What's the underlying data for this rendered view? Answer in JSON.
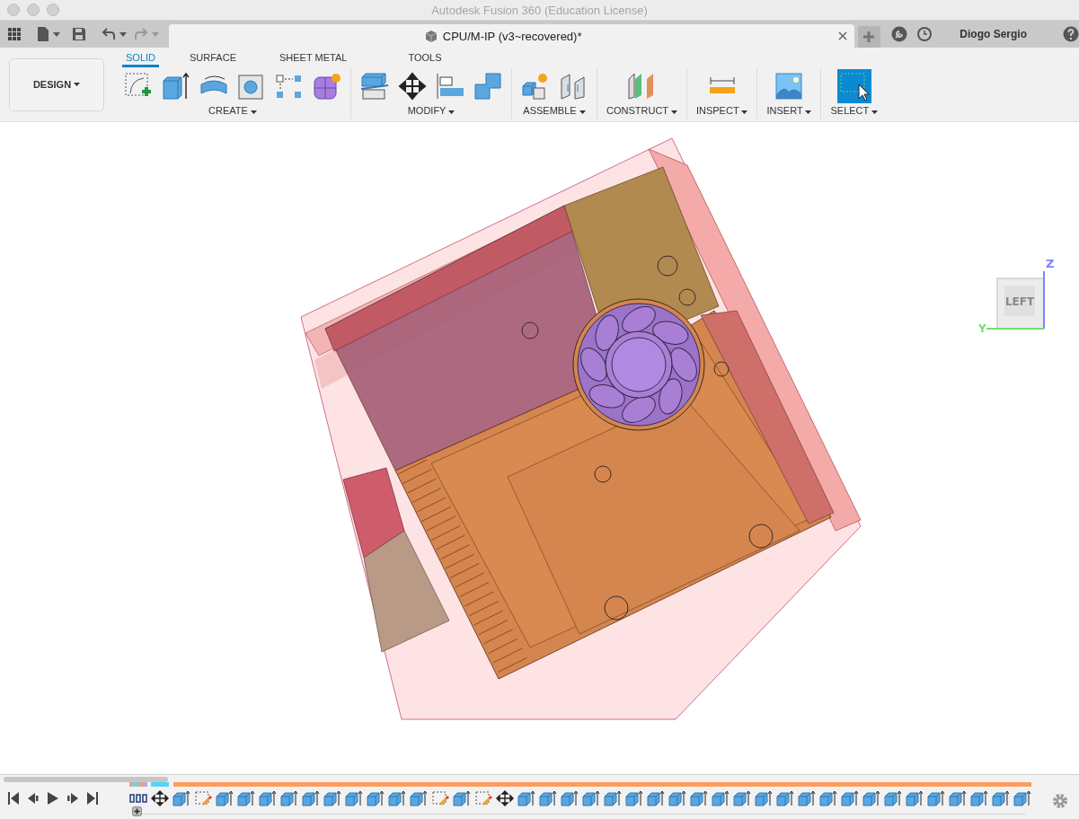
{
  "window": {
    "title": "Autodesk Fusion 360 (Education License)"
  },
  "document_tab": {
    "title": "CPU/M-IP (v3~recovered)*"
  },
  "user": {
    "name": "Diogo Sergio"
  },
  "workspace": {
    "label": "DESIGN"
  },
  "tabs": [
    {
      "label": "SOLID",
      "selected": true
    },
    {
      "label": "SURFACE",
      "selected": false
    },
    {
      "label": "SHEET METAL",
      "selected": false
    },
    {
      "label": "TOOLS",
      "selected": false
    }
  ],
  "tool_groups": [
    {
      "label": "CREATE",
      "tools": [
        {
          "kind": "sketch"
        },
        {
          "kind": "extrude"
        },
        {
          "kind": "revolve"
        },
        {
          "kind": "hole"
        },
        {
          "kind": "pattern"
        },
        {
          "kind": "form"
        }
      ]
    },
    {
      "label": "MODIFY",
      "tools": [
        {
          "kind": "press-pull"
        },
        {
          "kind": "move"
        },
        {
          "kind": "align"
        },
        {
          "kind": "combine"
        }
      ]
    },
    {
      "label": "ASSEMBLE",
      "tools": [
        {
          "kind": "new-component"
        },
        {
          "kind": "joint"
        }
      ]
    },
    {
      "label": "CONSTRUCT",
      "tools": [
        {
          "kind": "plane"
        }
      ]
    },
    {
      "label": "INSPECT",
      "tools": [
        {
          "kind": "measure"
        }
      ]
    },
    {
      "label": "INSERT",
      "tools": [
        {
          "kind": "image"
        }
      ]
    },
    {
      "label": "SELECT",
      "tools": [
        {
          "kind": "select"
        }
      ]
    }
  ],
  "view_cube": {
    "face": "LEFT",
    "axis_vertical": "Z",
    "axis_horizontal": "Y"
  },
  "timeline": {
    "features": [
      {
        "kind": "origin"
      },
      {
        "kind": "move"
      },
      {
        "kind": "extrude"
      },
      {
        "kind": "sketch"
      },
      {
        "kind": "extrude"
      },
      {
        "kind": "extrude"
      },
      {
        "kind": "extrude"
      },
      {
        "kind": "extrude"
      },
      {
        "kind": "extrude"
      },
      {
        "kind": "extrude"
      },
      {
        "kind": "extrude"
      },
      {
        "kind": "extrude"
      },
      {
        "kind": "extrude"
      },
      {
        "kind": "extrude"
      },
      {
        "kind": "sketch"
      },
      {
        "kind": "extrude"
      },
      {
        "kind": "sketch"
      },
      {
        "kind": "move"
      },
      {
        "kind": "extrude"
      },
      {
        "kind": "extrude"
      },
      {
        "kind": "extrude"
      },
      {
        "kind": "extrude"
      },
      {
        "kind": "extrude"
      },
      {
        "kind": "extrude"
      },
      {
        "kind": "extrude"
      },
      {
        "kind": "extrude"
      },
      {
        "kind": "extrude"
      },
      {
        "kind": "extrude"
      },
      {
        "kind": "extrude"
      },
      {
        "kind": "extrude"
      },
      {
        "kind": "extrude"
      },
      {
        "kind": "extrude"
      },
      {
        "kind": "extrude"
      },
      {
        "kind": "extrude"
      },
      {
        "kind": "extrude"
      },
      {
        "kind": "extrude"
      },
      {
        "kind": "extrude"
      },
      {
        "kind": "extrude"
      },
      {
        "kind": "extrude"
      },
      {
        "kind": "extrude"
      },
      {
        "kind": "extrude"
      },
      {
        "kind": "extrude"
      }
    ]
  }
}
